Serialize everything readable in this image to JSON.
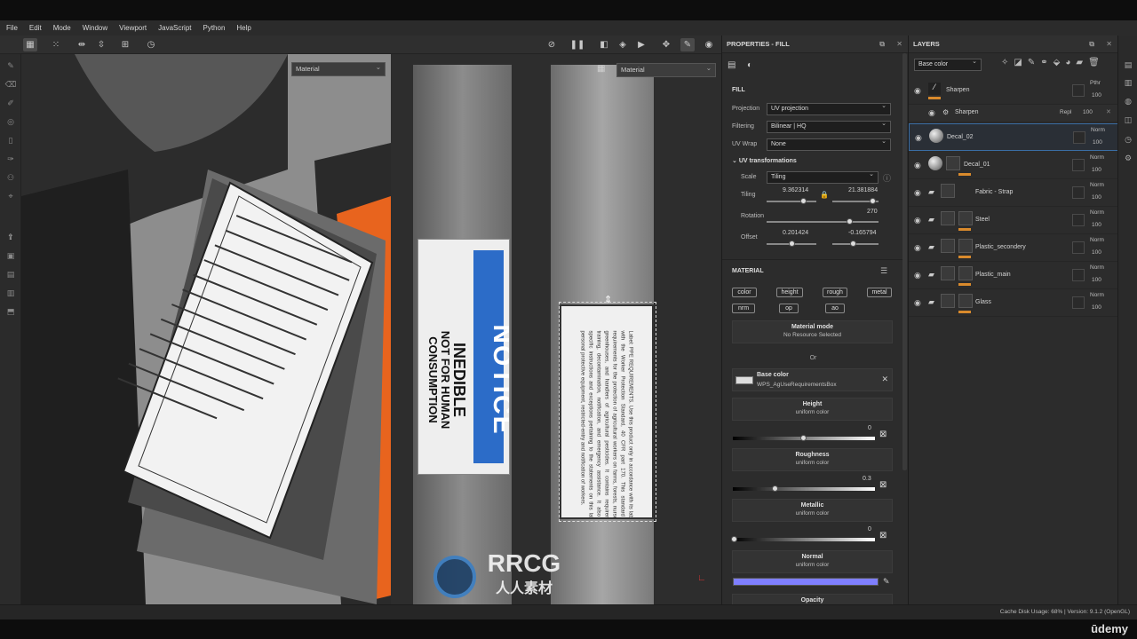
{
  "menu": [
    "File",
    "Edit",
    "Mode",
    "Window",
    "Viewport",
    "JavaScript",
    "Python",
    "Help"
  ],
  "viewport": {
    "left_dropdown": "Material",
    "right_dropdown": "Material",
    "sticker1_notice": "NOTICE",
    "sticker1_line1": "INEDIBLE",
    "sticker1_line2": "NOT FOR HUMAN",
    "sticker1_line3": "CONSUMPTION",
    "label_text": "Label: PPE REQUIREMENTS. Use this product only in accordance with its labeling and with the Worker Protection Standard, 40 CFR part 170. This standard contains requirements for the protection of agricultural workers on farms, forests, nurseries, and greenhouses, and handlers of agricultural pesticides. It contains requirements for training, decontamination, notification, and emergency assistance. It also contains specific instructions and exceptions pertaining to the statements on this label about personal protective equipment, restricted-entry and notification of workers.",
    "watermark_line1": "RRCG",
    "watermark_line2": "人人素材"
  },
  "properties": {
    "title": "PROPERTIES - FILL",
    "section_fill": "FILL",
    "projection_label": "Projection",
    "projection_value": "UV projection",
    "filtering_label": "Filtering",
    "filtering_value": "Bilinear | HQ",
    "uvwrap_label": "UV Wrap",
    "uvwrap_value": "None",
    "uvtrans_label": "UV transformations",
    "scale_label": "Scale",
    "scale_value": "Tiling",
    "tiling_label": "Tiling",
    "tiling_x": "9.362314",
    "tiling_y": "21.381884",
    "rotation_label": "Rotation",
    "rotation_value": "270",
    "offset_label": "Offset",
    "offset_x": "0.201424",
    "offset_y": "-0.165794",
    "section_material": "MATERIAL",
    "channels": [
      "color",
      "height",
      "rough",
      "metal",
      "nrm",
      "op",
      "ao"
    ],
    "material_mode_title": "Material mode",
    "material_mode_value": "No Resource Selected",
    "or": "Or",
    "basecolor_title": "Base color",
    "basecolor_resource": "WPS_AgUseRequirementsBox",
    "height_title": "Height",
    "height_sub": "uniform color",
    "height_value": "0",
    "roughness_title": "Roughness",
    "roughness_sub": "uniform color",
    "roughness_value": "0.3",
    "metallic_title": "Metallic",
    "metallic_sub": "uniform color",
    "metallic_value": "0",
    "normal_title": "Normal",
    "normal_sub": "uniform color",
    "normal_color": "#7f7fff",
    "opacity_title": "Opacity"
  },
  "layers": {
    "title": "LAYERS",
    "channel_select": "Base color",
    "items": [
      {
        "name": "Sharpen",
        "blend": "Pthr",
        "opacity": "100"
      },
      {
        "name": "Sharpen",
        "blend": "Repl",
        "opacity": "100"
      },
      {
        "name": "Decal_02",
        "blend": "Norm",
        "opacity": "100"
      },
      {
        "name": "Decal_01",
        "blend": "Norm",
        "opacity": "100"
      },
      {
        "name": "Fabric - Strap",
        "blend": "Norm",
        "opacity": "100"
      },
      {
        "name": "Steel",
        "blend": "Norm",
        "opacity": "100"
      },
      {
        "name": "Plastic_secondery",
        "blend": "Norm",
        "opacity": "100"
      },
      {
        "name": "Plastic_main",
        "blend": "Norm",
        "opacity": "100"
      },
      {
        "name": "Glass",
        "blend": "Norm",
        "opacity": "100"
      }
    ]
  },
  "status": {
    "cache": "Cache Disk Usage:",
    "cache_value": "68%",
    "version": "| Version: 9.1.2 (OpenGL)"
  },
  "brand": "ūdemy",
  "colors": {
    "accent": "#d98a2c",
    "selection": "#3a6ea5",
    "orange_mat": "#e8641e",
    "notice_blue": "#2c6cc8"
  }
}
